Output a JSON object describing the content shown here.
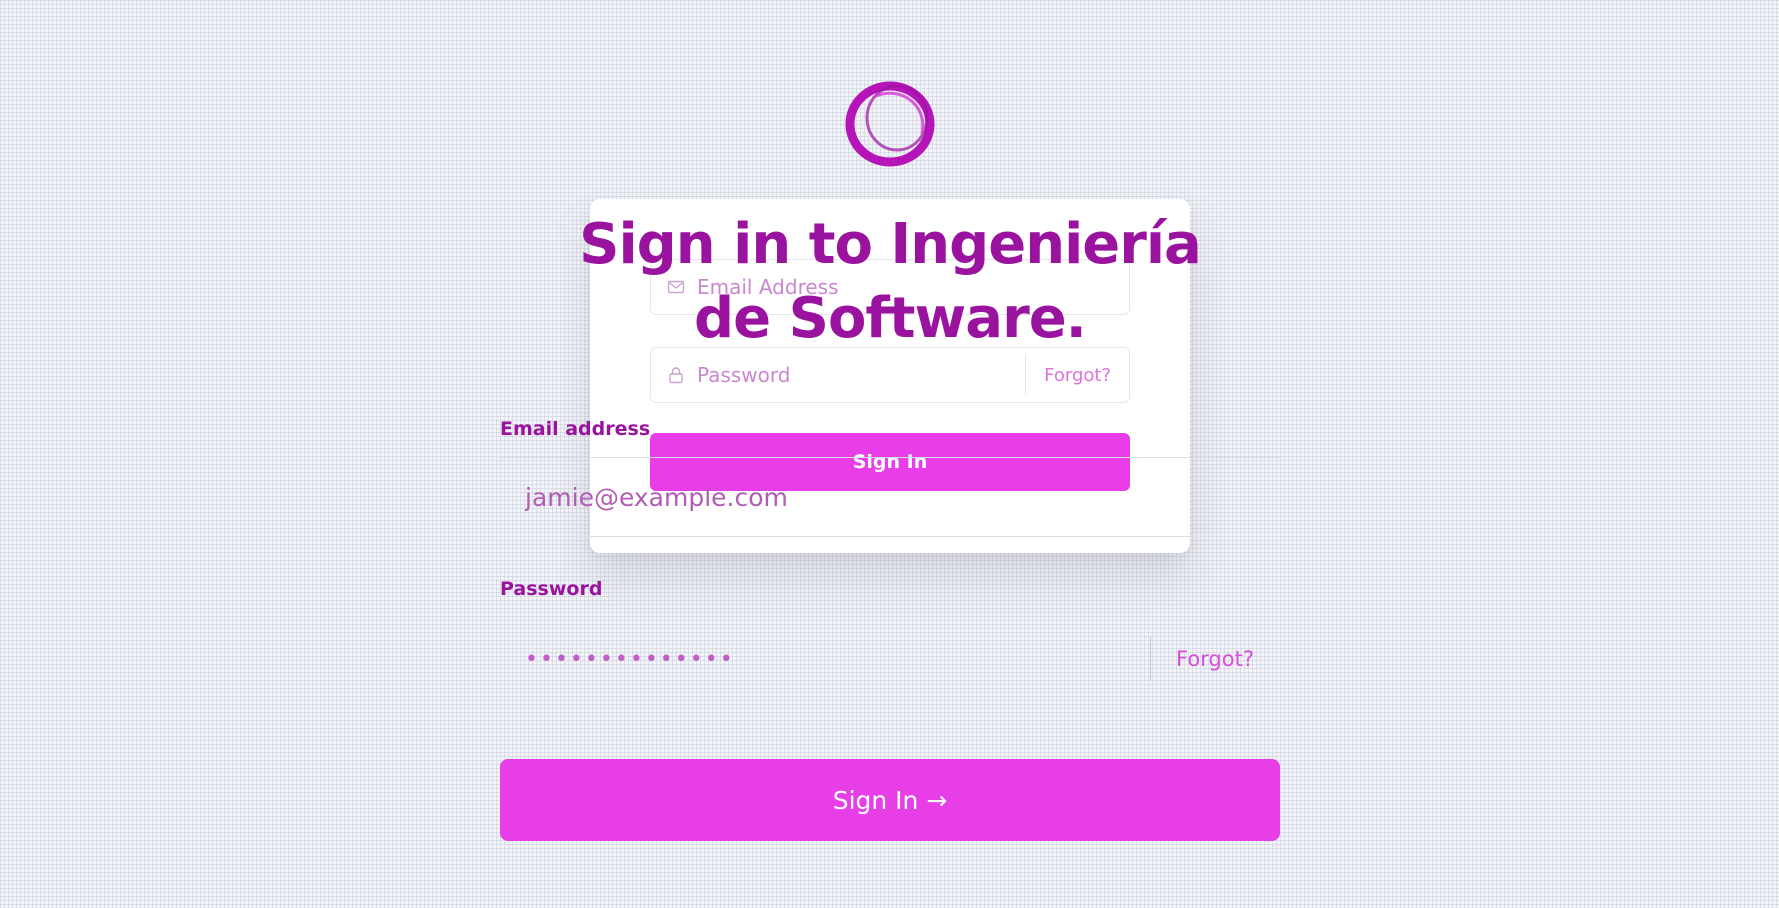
{
  "colors": {
    "accent": "#e83ee8",
    "title": "#9a139e",
    "background": "#f3f4f7"
  },
  "logo": {
    "icon": "ring-logo-icon"
  },
  "back_card": {
    "email_placeholder": "Email Address",
    "email_icon": "mail-icon",
    "password_placeholder": "Password",
    "password_icon": "lock-icon",
    "forgot_label": "Forgot?",
    "signin_label": "Sign In"
  },
  "title": "Sign in to Ingeniería de Software.",
  "form": {
    "email_label": "Email address",
    "email_value": "jamie@example.com",
    "password_label": "Password",
    "password_value": "••••••••••••••",
    "forgot_label": "Forgot?",
    "signin_label": "Sign In →"
  }
}
